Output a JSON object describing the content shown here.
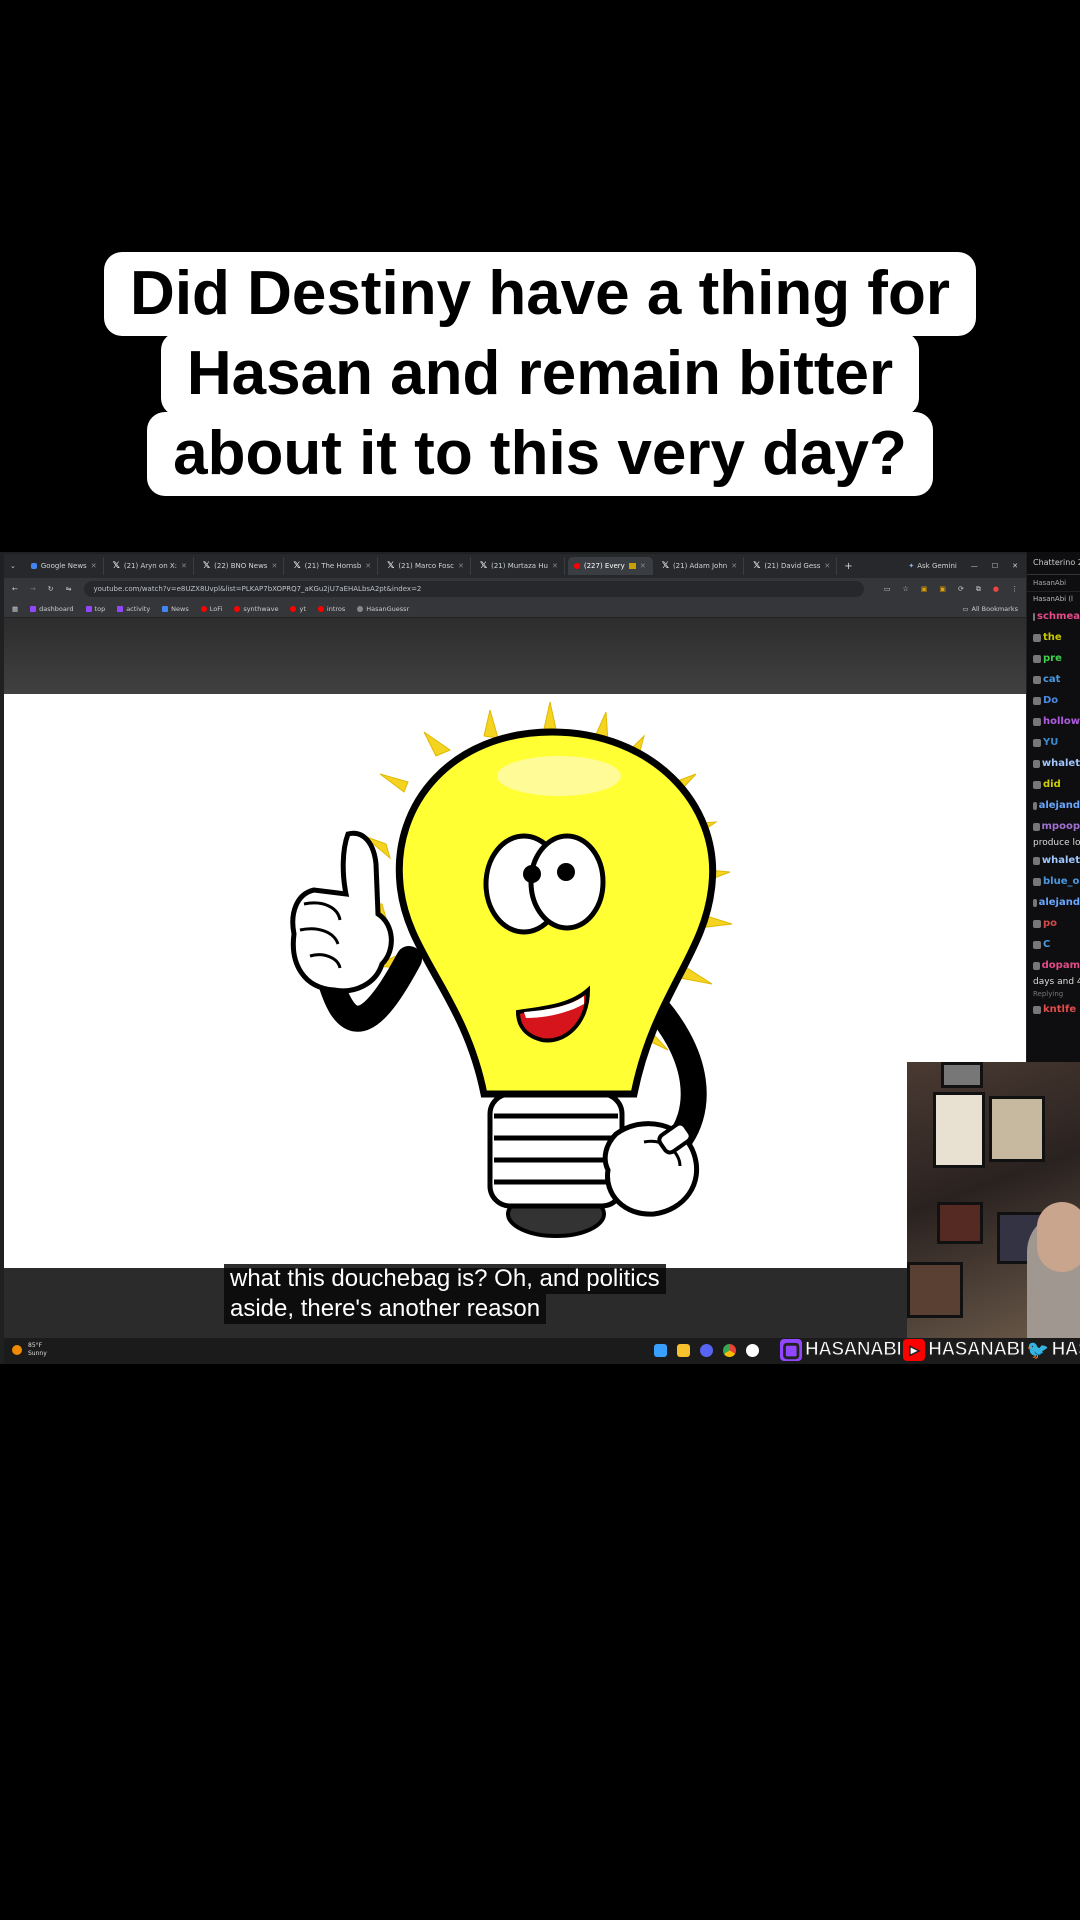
{
  "caption": {
    "lines": [
      "Did Destiny have a thing for",
      "Hasan and remain bitter",
      "about it to this very day?"
    ]
  },
  "browser": {
    "tabs": [
      {
        "label": "Google News",
        "icon": "google-news-icon",
        "active": false
      },
      {
        "label": "(21) Aryn on X:",
        "icon": "x-icon",
        "active": false
      },
      {
        "label": "(22) BNO News",
        "icon": "x-icon",
        "active": false
      },
      {
        "label": "(21) The Hornsb",
        "icon": "x-icon",
        "active": false
      },
      {
        "label": "(21) Marco Fosc",
        "icon": "x-icon",
        "active": false
      },
      {
        "label": "(21) Murtaza Hu",
        "icon": "x-icon",
        "active": false
      },
      {
        "label": "(227) Every",
        "icon": "youtube-icon",
        "active": true
      },
      {
        "label": "(21) Adam John",
        "icon": "x-icon",
        "active": false
      },
      {
        "label": "(21) David Gess",
        "icon": "x-icon",
        "active": false
      }
    ],
    "ask_gemini": "Ask Gemini",
    "url": "youtube.com/watch?v=e8UZX8Uvpl&list=PLKAP7bXOPRQ7_aKGu2jU7aEHALbsA2pt&index=2",
    "bookmarks": [
      "dashboard",
      "top",
      "activity",
      "News",
      "LoFi",
      "synthwave",
      "yt",
      "intros",
      "HasanGuessr"
    ],
    "all_bookmarks": "All Bookmarks"
  },
  "video": {
    "subtitle_lines": [
      "what this douchebag is? Oh, and politics",
      "aside, there's another reason"
    ]
  },
  "taskbar": {
    "temp": "85°F",
    "condition": "Sunny",
    "socials": [
      "HASANABI",
      "HASANABI",
      "HASA"
    ]
  },
  "chat": {
    "title": "Chatterino 2",
    "tab": "HasanAbi",
    "channel": "HasanAbi (l",
    "rows": [
      {
        "name": "schmea",
        "color": "#e34a8a"
      },
      {
        "name": "the",
        "color": "#c8c800"
      },
      {
        "name": "pre",
        "color": "#3fd14a"
      },
      {
        "name": "cat",
        "color": "#4a9ae3"
      },
      {
        "name": "Do",
        "color": "#4a8ae3"
      },
      {
        "name": "hollow",
        "color": "#b05ce0"
      },
      {
        "name": "YU",
        "color": "#3a8ad0"
      },
      {
        "name": "whalet",
        "color": "#a0c8ff"
      },
      {
        "name": "did",
        "color": "#d0d000"
      },
      {
        "name": "alejand",
        "color": "#6aa8ff"
      },
      {
        "name": "mpoop",
        "color": "#a070d0"
      }
    ],
    "plain1": "produce lo",
    "rows2": [
      {
        "name": "whalet",
        "color": "#a0c8ff"
      },
      {
        "name": "blue_o",
        "color": "#4a9ae3"
      },
      {
        "name": "alejand",
        "color": "#6aa8ff"
      },
      {
        "name": "po",
        "color": "#d04a4a"
      },
      {
        "name": "C",
        "color": "#4a9ae3"
      },
      {
        "name": "dopam",
        "color": "#e34a8a"
      }
    ],
    "plain2": "days and 4",
    "reply": "Replying",
    "last": {
      "name": "kntlfe",
      "color": "#e34a4a"
    }
  }
}
